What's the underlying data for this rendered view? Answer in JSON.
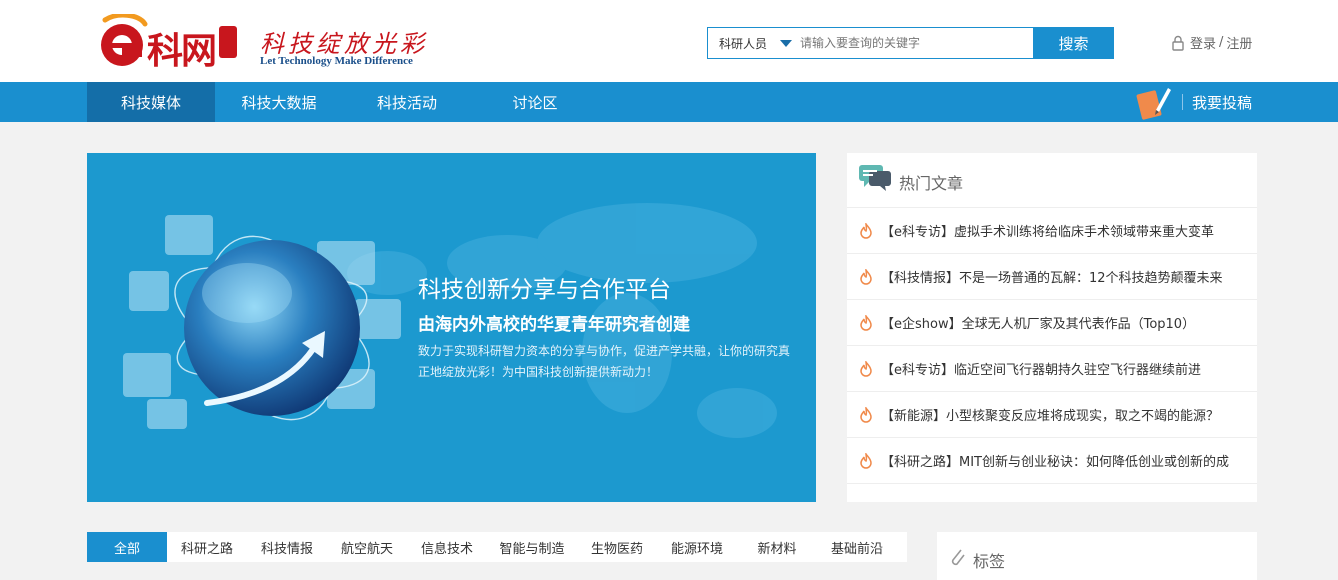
{
  "brand": {
    "logo_name": "科网",
    "slogan": "科技绽放光彩",
    "tagline": "Let Technology Make Difference"
  },
  "search": {
    "category": "科研人员",
    "placeholder": "请输入要查询的关键字",
    "button_label": "搜索"
  },
  "account": {
    "login_label": "登录",
    "separator": "/",
    "register_label": "注册"
  },
  "nav": {
    "items": [
      {
        "label": "科技媒体"
      },
      {
        "label": "科技大数据"
      },
      {
        "label": "科技活动"
      },
      {
        "label": "讨论区"
      }
    ],
    "contribute_label": "我要投稿"
  },
  "banner": {
    "title": "科技创新分享与合作平台",
    "subtitle": "由海内外高校的华夏青年研究者创建",
    "description": "致力于实现科研智力资本的分享与协作，促进产学共融，让你的研究真正地绽放光彩！为中国科技创新提供新动力！"
  },
  "hot_articles": {
    "title": "热门文章",
    "items": [
      {
        "text": "【e科专访】虚拟手术训练将给临床手术领域带来重大变革"
      },
      {
        "text": "【科技情报】不是一场普通的瓦解：12个科技趋势颠覆未来"
      },
      {
        "text": "【e企show】全球无人机厂家及其代表作品（Top10）"
      },
      {
        "text": "【e科专访】临近空间飞行器朝持久驻空飞行器继续前进"
      },
      {
        "text": "【新能源】小型核聚变反应堆将成现实，取之不竭的能源？"
      },
      {
        "text": "【科研之路】MIT创新与创业秘诀：如何降低创业或创新的成"
      }
    ]
  },
  "categories": [
    {
      "label": "全部"
    },
    {
      "label": "科研之路"
    },
    {
      "label": "科技情报"
    },
    {
      "label": "航空航天"
    },
    {
      "label": "信息技术"
    },
    {
      "label": "智能与制造"
    },
    {
      "label": "生物医药"
    },
    {
      "label": "能源环境"
    },
    {
      "label": "新材料"
    },
    {
      "label": "基础前沿"
    }
  ],
  "tags_panel": {
    "title": "标签"
  },
  "colors": {
    "primary": "#1a8fcf",
    "nav_active": "#146ea8",
    "brand_red": "#c8161d",
    "hot_icon": "#f08a4b"
  }
}
